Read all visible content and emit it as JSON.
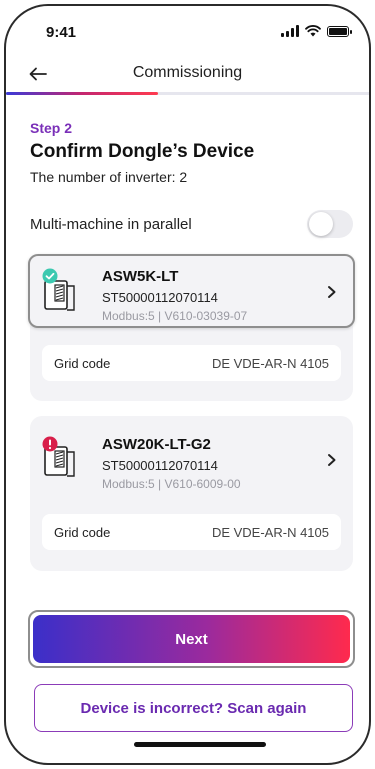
{
  "status_bar": {
    "time": "9:41"
  },
  "header": {
    "title": "Commissioning",
    "progress_fraction": 0.42
  },
  "step": {
    "label": "Step 2",
    "title": "Confirm Dongle’s Device",
    "inverter_count": "The number of inverter: 2"
  },
  "parallel": {
    "label": "Multi-machine in parallel",
    "enabled": false
  },
  "devices": [
    {
      "name": "ASW5K-LT",
      "serial": "ST50000112070114",
      "meta": "Modbus:5 | V610-03039-07",
      "status": "ok",
      "status_color": "#3cc9b0",
      "grid_code_label": "Grid code",
      "grid_code_value": "DE VDE-AR-N 4105"
    },
    {
      "name": "ASW20K-LT-G2",
      "serial": "ST50000112070114",
      "meta": "Modbus:5 | V610-6009-00",
      "status": "error",
      "status_color": "#d81e4a",
      "grid_code_label": "Grid code",
      "grid_code_value": "DE VDE-AR-N 4105"
    }
  ],
  "buttons": {
    "next": "Next",
    "scan_again": "Device is incorrect? Scan again"
  },
  "colors": {
    "accent_purple": "#7a2fb8",
    "gradient_start": "#3b2fc9",
    "gradient_end": "#ff2a4d"
  }
}
